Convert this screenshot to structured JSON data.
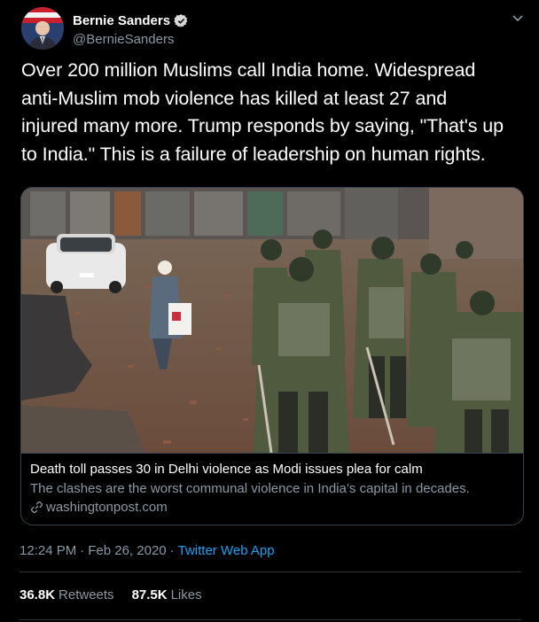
{
  "author": {
    "display_name": "Bernie Sanders",
    "handle": "@BernieSanders",
    "verified": true
  },
  "tweet": {
    "text_lines": [
      "Over 200 million Muslims call India home. Widespread",
      "anti-Muslim mob violence has killed at least 27 and",
      "injured many more. Trump responds by saying, \"That's up",
      "to India.\" This is a failure of leadership on human rights."
    ]
  },
  "card": {
    "title": "Death toll passes 30 in Delhi violence as Modi issues plea for calm",
    "description": "The clashes are the worst communal violence in India’s capital in decades.",
    "domain": "washingtonpost.com"
  },
  "meta": {
    "time": "12:24 PM",
    "separator": "·",
    "date": "Feb 26, 2020",
    "separator2": "·",
    "app": "Twitter Web App"
  },
  "stats": {
    "retweets_count": "36.8K",
    "retweets_label": "Retweets",
    "likes_count": "87.5K",
    "likes_label": "Likes"
  },
  "colors": {
    "background": "#000000",
    "text": "#ffffff",
    "secondary": "#8b98a5",
    "accent": "#1da1f2",
    "border": "#38444d"
  },
  "icons": {
    "verified": "verified-badge-icon",
    "caret": "chevron-down-icon",
    "link": "link-icon"
  }
}
